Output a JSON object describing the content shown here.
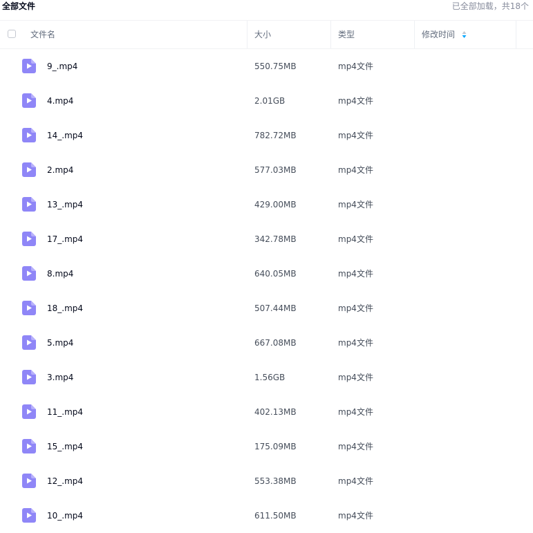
{
  "breadcrumb": "全部文件",
  "load_status": "已全部加载，共18个",
  "columns": {
    "name": "文件名",
    "size": "大小",
    "type": "类型",
    "modified": "修改时间"
  },
  "files": [
    {
      "name": "9_.mp4",
      "size": "550.75MB",
      "type": "mp4文件"
    },
    {
      "name": "4.mp4",
      "size": "2.01GB",
      "type": "mp4文件"
    },
    {
      "name": "14_.mp4",
      "size": "782.72MB",
      "type": "mp4文件"
    },
    {
      "name": "2.mp4",
      "size": "577.03MB",
      "type": "mp4文件"
    },
    {
      "name": "13_.mp4",
      "size": "429.00MB",
      "type": "mp4文件"
    },
    {
      "name": "17_.mp4",
      "size": "342.78MB",
      "type": "mp4文件"
    },
    {
      "name": "8.mp4",
      "size": "640.05MB",
      "type": "mp4文件"
    },
    {
      "name": "18_.mp4",
      "size": "507.44MB",
      "type": "mp4文件"
    },
    {
      "name": "5.mp4",
      "size": "667.08MB",
      "type": "mp4文件"
    },
    {
      "name": "3.mp4",
      "size": "1.56GB",
      "type": "mp4文件"
    },
    {
      "name": "11_.mp4",
      "size": "402.13MB",
      "type": "mp4文件"
    },
    {
      "name": "15_.mp4",
      "size": "175.09MB",
      "type": "mp4文件"
    },
    {
      "name": "12_.mp4",
      "size": "553.38MB",
      "type": "mp4文件"
    },
    {
      "name": "10_.mp4",
      "size": "611.50MB",
      "type": "mp4文件"
    }
  ],
  "colors": {
    "video_icon": "#8f86f7",
    "sort_active": "#06a7ff",
    "sort_inactive": "#c4c8d0"
  },
  "icons": {
    "file": "video-file-icon",
    "sort": "sort-icon"
  }
}
